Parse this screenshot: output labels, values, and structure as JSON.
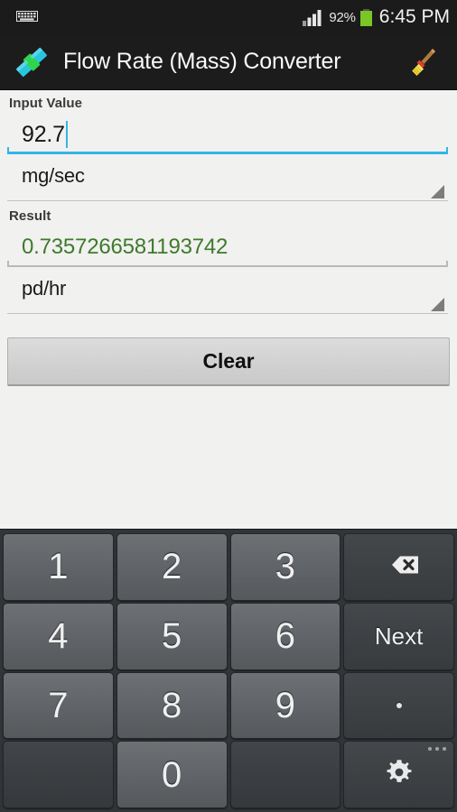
{
  "status_bar": {
    "keyboard_icon": "keyboard-icon",
    "signal_icon": "signal-bars-icon",
    "battery_percent": "92%",
    "battery_icon": "battery-icon",
    "clock": "6:45 PM"
  },
  "action_bar": {
    "app_icon": "flow-pipe-icon",
    "title": "Flow Rate (Mass) Converter",
    "clear_action_icon": "broom-icon"
  },
  "form": {
    "input_label": "Input Value",
    "input_value": "92.7",
    "input_unit": "mg/sec",
    "result_label": "Result",
    "result_value": "0.7357266581193742",
    "result_unit": "pd/hr",
    "clear_button": "Clear"
  },
  "colors": {
    "accent_blue": "#33b5e5",
    "result_green": "#3e7a2c",
    "battery_green": "#7ac624",
    "action_bar_bg": "#1c1c1c",
    "keyboard_bg": "#313538"
  },
  "keyboard": {
    "rows": [
      [
        {
          "label": "1",
          "type": "num",
          "name": "key-1"
        },
        {
          "label": "2",
          "type": "num",
          "name": "key-2"
        },
        {
          "label": "3",
          "type": "num",
          "name": "key-3"
        },
        {
          "label": "",
          "type": "fn",
          "name": "key-backspace",
          "icon": "backspace-icon"
        }
      ],
      [
        {
          "label": "4",
          "type": "num",
          "name": "key-4"
        },
        {
          "label": "5",
          "type": "num",
          "name": "key-5"
        },
        {
          "label": "6",
          "type": "num",
          "name": "key-6"
        },
        {
          "label": "Next",
          "type": "fn",
          "name": "key-next"
        }
      ],
      [
        {
          "label": "7",
          "type": "num",
          "name": "key-7"
        },
        {
          "label": "8",
          "type": "num",
          "name": "key-8"
        },
        {
          "label": "9",
          "type": "num",
          "name": "key-9"
        },
        {
          "label": ".",
          "type": "fn",
          "name": "key-period",
          "icon": "dot-icon"
        }
      ],
      [
        {
          "label": "",
          "type": "blank",
          "name": "key-blank-left"
        },
        {
          "label": "0",
          "type": "num",
          "name": "key-0"
        },
        {
          "label": "",
          "type": "blank",
          "name": "key-blank-right"
        },
        {
          "label": "",
          "type": "fn",
          "name": "key-settings",
          "icon": "gear-icon"
        }
      ]
    ]
  }
}
